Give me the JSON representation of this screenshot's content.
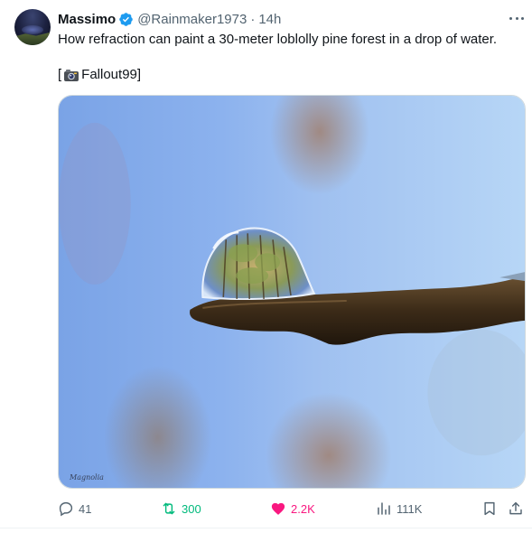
{
  "author": {
    "name": "Massimo",
    "handle": "@Rainmaker1973",
    "separator": "·",
    "time": "14h",
    "verified": true
  },
  "tweet": {
    "text": "How refraction can paint a 30-meter loblolly pine forest in a drop of water.",
    "credit_open": "[",
    "credit_icon": "camera-icon",
    "credit_name": "Fallout99",
    "credit_close": "]"
  },
  "media": {
    "watermark": "Magnolia"
  },
  "actions": {
    "replies": "41",
    "reposts": "300",
    "likes": "2.2K",
    "views": "111K"
  },
  "colors": {
    "accent": "#1d9bf0",
    "repost": "#00ba7c",
    "like": "#f91880",
    "muted": "#536471"
  }
}
